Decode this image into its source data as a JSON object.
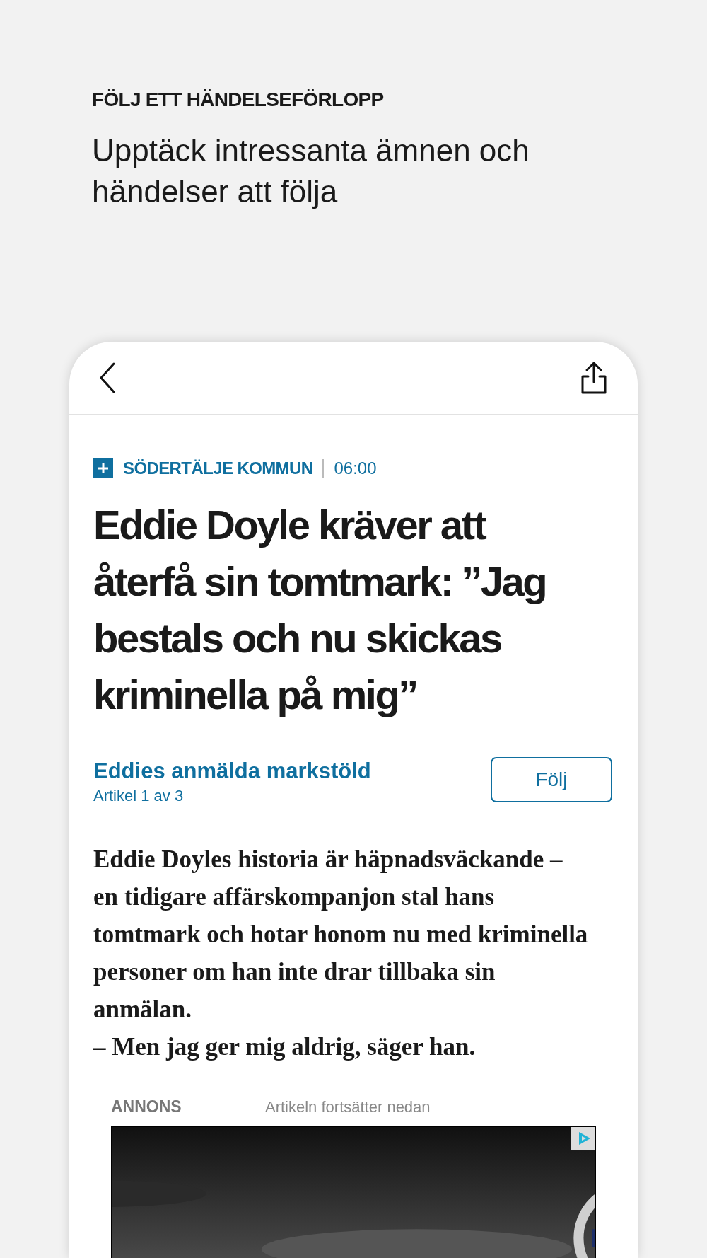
{
  "intro": {
    "eyebrow": "FÖLJ ETT HÄNDELSEFÖRLOPP",
    "title": "Upptäck intressanta ämnen och händelser att följa"
  },
  "article": {
    "category": "SÖDERTÄLJE KOMMUN",
    "time": "06:00",
    "headline": "Eddie Doyle kräver att återfå sin tomtmark: ”Jag bestals och nu skickas kriminella på mig”",
    "story": {
      "title": "Eddies anmälda markstöld",
      "position": "Artikel 1 av 3",
      "button": "Följ"
    },
    "lead": "Eddie Doyles historia är häpnadsväckande – en tidigare affärskompanjon stal hans tomtmark och hotar honom nu med kriminella personer om han inte drar tillbaka sin anmälan.\n– Men jag ger mig aldrig, säger han.",
    "ad": {
      "label": "ANNONS",
      "note": "Artikeln fortsätter nedan"
    }
  }
}
